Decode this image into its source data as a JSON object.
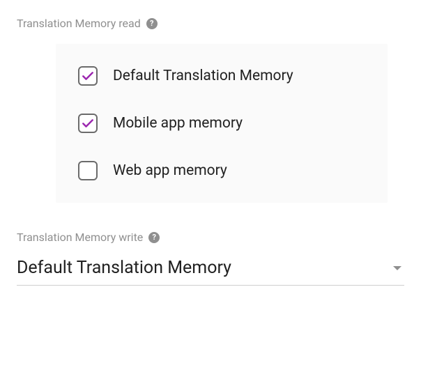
{
  "read": {
    "label": "Translation Memory read",
    "items": [
      {
        "label": "Default Translation Memory",
        "checked": true
      },
      {
        "label": "Mobile app memory",
        "checked": true
      },
      {
        "label": "Web app memory",
        "checked": false
      }
    ]
  },
  "write": {
    "label": "Translation Memory write",
    "selected": "Default Translation Memory"
  },
  "helpGlyph": "?"
}
